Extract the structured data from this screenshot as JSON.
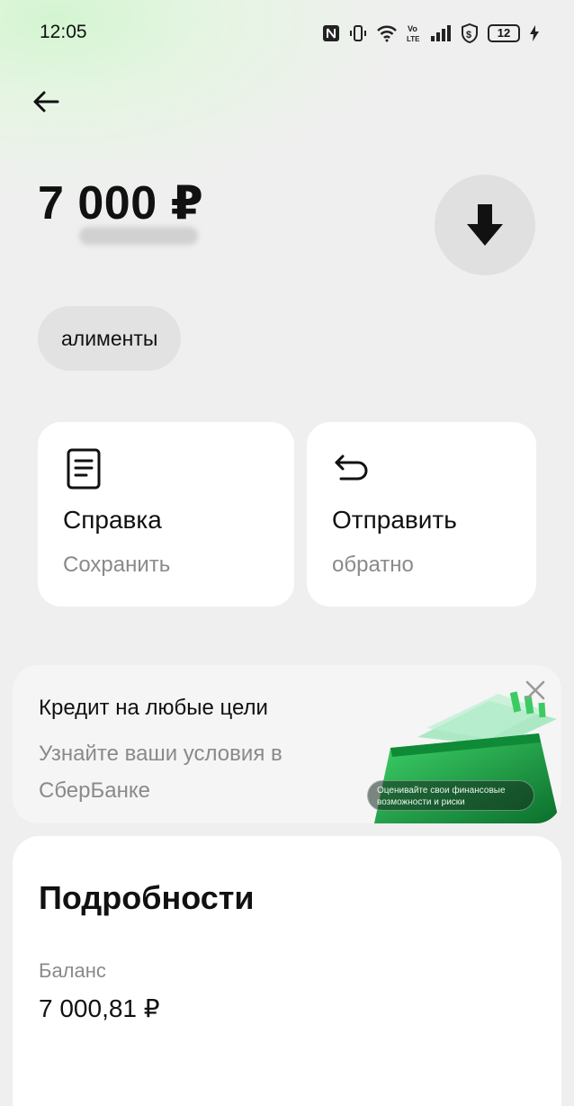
{
  "status_bar": {
    "time": "12:05",
    "battery": "12",
    "icons": [
      "nfc-icon",
      "vibrate-icon",
      "wifi-icon",
      "volte-icon",
      "signal-icon",
      "shield-dollar-icon",
      "battery-icon",
      "charging-icon"
    ]
  },
  "header": {
    "back_icon": "arrow-left-icon"
  },
  "transaction": {
    "amount": "7 000 ₽",
    "download_icon": "arrow-down-icon",
    "tag": "алименты"
  },
  "actions": [
    {
      "title": "Справка",
      "subtitle": "Сохранить",
      "icon": "document-icon"
    },
    {
      "title": "Отправить",
      "subtitle": "обратно",
      "icon": "return-arrow-icon"
    }
  ],
  "promo": {
    "title": "Кредит на любые цели",
    "subtitle": "Узнайте ваши условия в СберБанке",
    "caption": "Оценивайте свои финансовые возможности и риски",
    "close_icon": "close-icon"
  },
  "details": {
    "title": "Подробности",
    "balance_label": "Баланс",
    "balance_value": "7 000,81 ₽"
  },
  "colors": {
    "background": "#efefef",
    "card": "#ffffff",
    "accent_green": "#21a038",
    "muted_text": "#8a8a8a"
  }
}
